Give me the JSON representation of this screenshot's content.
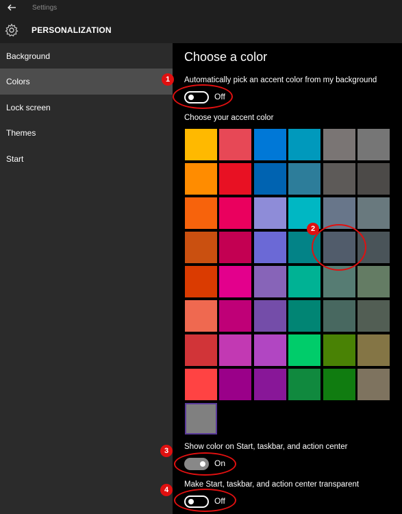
{
  "titlebar": {
    "app_title": "Settings",
    "back_icon": "back-arrow-icon"
  },
  "header": {
    "title": "PERSONALIZATION",
    "icon": "gear-icon"
  },
  "sidebar": {
    "items": [
      {
        "label": "Background",
        "selected": false
      },
      {
        "label": "Colors",
        "selected": true
      },
      {
        "label": "Lock screen",
        "selected": false
      },
      {
        "label": "Themes",
        "selected": false
      },
      {
        "label": "Start",
        "selected": false
      }
    ]
  },
  "main": {
    "heading": "Choose a color",
    "auto_pick": {
      "label": "Automatically pick an accent color from my background",
      "state": "Off",
      "on": false
    },
    "accent_label": "Choose your accent color",
    "accent_colors": [
      "#ffb900",
      "#e74856",
      "#0078d7",
      "#0099bc",
      "#7a7574",
      "#767676",
      "#ff8c00",
      "#e81123",
      "#0063b1",
      "#2d7d9a",
      "#5d5a58",
      "#4c4a48",
      "#f7630c",
      "#ea005e",
      "#8e8cd8",
      "#00b7c3",
      "#68768a",
      "#69797e",
      "#ca5010",
      "#c30052",
      "#6b69d6",
      "#038387",
      "#515c6b",
      "#4a5459",
      "#da3b01",
      "#e3008c",
      "#8764b8",
      "#00b294",
      "#567c73",
      "#647c64",
      "#ef6950",
      "#bf0077",
      "#744da9",
      "#018574",
      "#486860",
      "#525e54",
      "#d13438",
      "#c239b3",
      "#b146c2",
      "#00cc6a",
      "#498205",
      "#847545",
      "#ff4343",
      "#9a0089",
      "#881798",
      "#10893e",
      "#107c10",
      "#7e735f",
      "#808080"
    ],
    "selected_color_index": 48,
    "show_color": {
      "label": "Show color on Start, taskbar, and action center",
      "state": "On",
      "on": true
    },
    "transparent": {
      "label": "Make Start, taskbar, and action center transparent",
      "state": "Off",
      "on": false
    }
  },
  "annotations": {
    "color": "#e01010",
    "markers": [
      "1",
      "2",
      "3",
      "4"
    ]
  }
}
